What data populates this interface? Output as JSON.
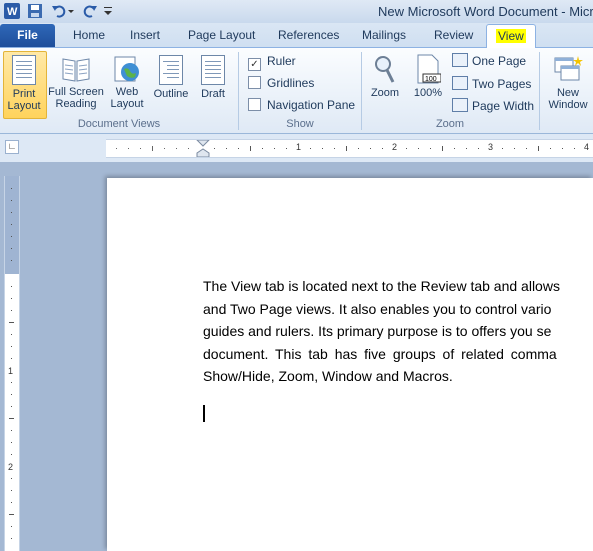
{
  "title_bar": {
    "title": "New Microsoft Word Document - Micro",
    "qat_icons": [
      "word-icon",
      "save-icon",
      "undo-icon",
      "dropdown-icon",
      "redo-icon",
      "customize-qat-icon"
    ]
  },
  "tabs": [
    {
      "label": "File"
    },
    {
      "label": "Home"
    },
    {
      "label": "Insert"
    },
    {
      "label": "Page Layout"
    },
    {
      "label": "References"
    },
    {
      "label": "Mailings"
    },
    {
      "label": "Review"
    },
    {
      "label": "View"
    }
  ],
  "ribbon": {
    "document_views": {
      "group_label": "Document Views",
      "buttons": [
        {
          "label_line1": "Print",
          "label_line2": "Layout"
        },
        {
          "label_line1": "Full Screen",
          "label_line2": "Reading"
        },
        {
          "label_line1": "Web",
          "label_line2": "Layout"
        },
        {
          "label_line1": "Outline",
          "label_line2": ""
        },
        {
          "label_line1": "Draft",
          "label_line2": ""
        }
      ]
    },
    "show": {
      "group_label": "Show",
      "ruler": "Ruler",
      "gridlines": "Gridlines",
      "navigation_pane": "Navigation Pane"
    },
    "zoom": {
      "group_label": "Zoom",
      "zoom": "Zoom",
      "hundred": "100%",
      "one_page": "One Page",
      "two_pages": "Two Pages",
      "page_width": "Page Width"
    },
    "window": {
      "new_window_line1": "New",
      "new_window_line2": "Window"
    }
  },
  "ruler": {
    "numbers": [
      "1",
      "2",
      "3",
      "4"
    ],
    "vertical_numbers": [
      "1",
      "2"
    ]
  },
  "document": {
    "paragraph": "The View tab is located next to the Review tab and allows you to switch between Print Layout, Full Screen Reading, Web Layout, Outline, Draft, One Page and Two Page views. It also enables you to control various guides and rulers. Its primary purpose is to offers you several ways to view your document. This tab has five groups of related commands: Document Views, Show/Hide, Zoom, Window and Macros.",
    "lines": [
      "The View tab is located next to the Review tab and allows",
      "and Two Page views. It also enables you to control vario",
      "guides and rulers. Its primary purpose is to offers you se",
      "document. This tab has five groups of related comma",
      "Show/Hide, Zoom, Window and Macros."
    ]
  }
}
